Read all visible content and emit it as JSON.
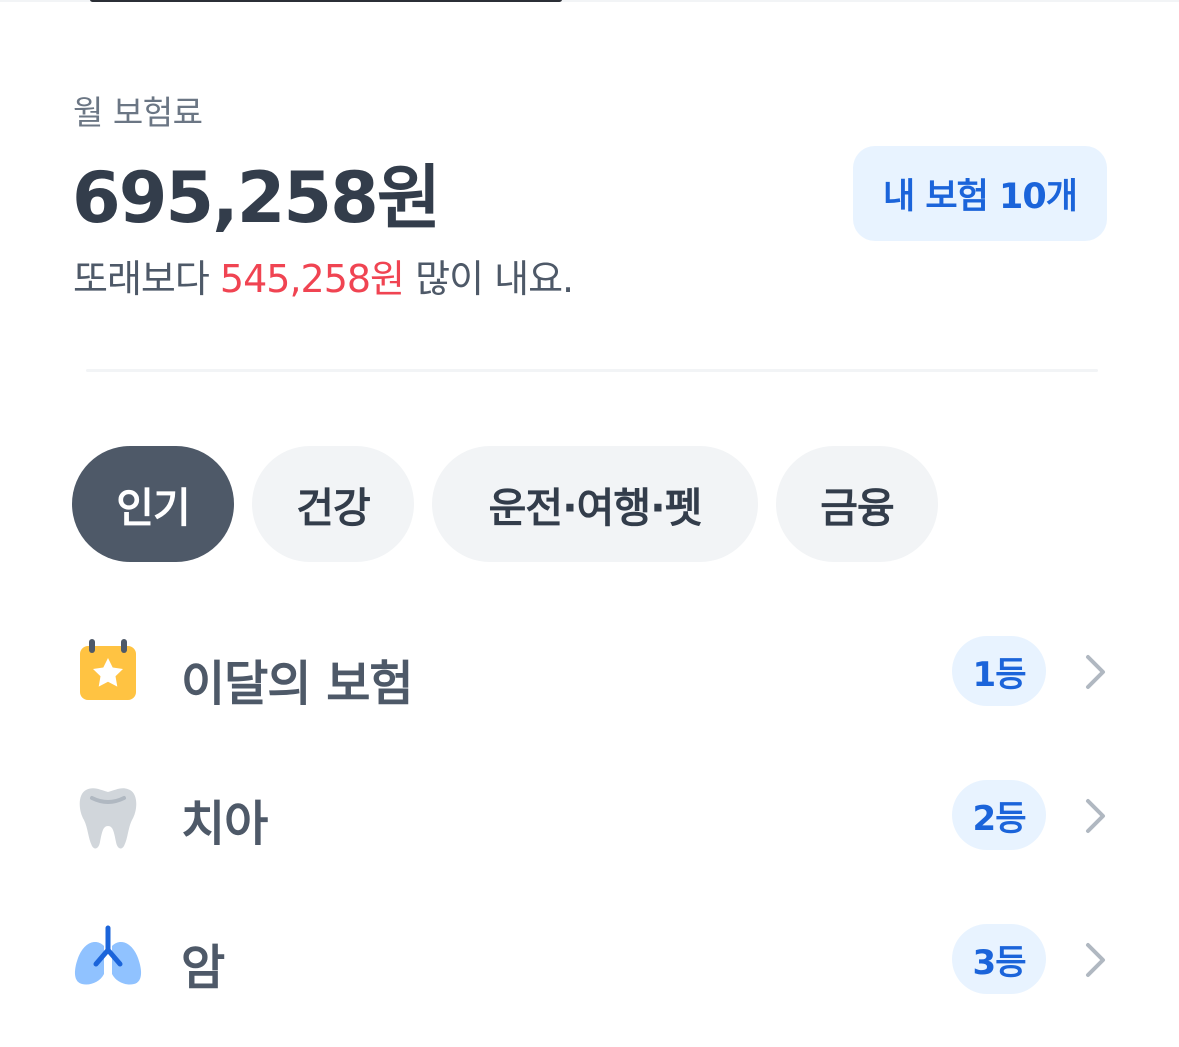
{
  "summary": {
    "label": "월 보험료",
    "amount": "695,258원",
    "compare_prefix": "또래보다 ",
    "compare_diff": "545,258원",
    "compare_suffix": " 많이 내요.",
    "my_insurance_button": "내 보험 10개"
  },
  "tabs": [
    {
      "label": "인기",
      "active": true
    },
    {
      "label": "건강",
      "active": false
    },
    {
      "label": "운전·여행·펫",
      "active": false
    },
    {
      "label": "금융",
      "active": false
    }
  ],
  "rankings": [
    {
      "label": "이달의 보험",
      "rank": "1등",
      "icon": "calendar-star-icon"
    },
    {
      "label": "치아",
      "rank": "2등",
      "icon": "tooth-icon"
    },
    {
      "label": "암",
      "rank": "3등",
      "icon": "lungs-icon"
    }
  ],
  "colors": {
    "accent_blue": "#1b64da",
    "badge_bg": "#e8f3ff",
    "diff_red": "#f04452",
    "active_chip": "#4e5968",
    "inactive_chip": "#f2f4f6"
  }
}
